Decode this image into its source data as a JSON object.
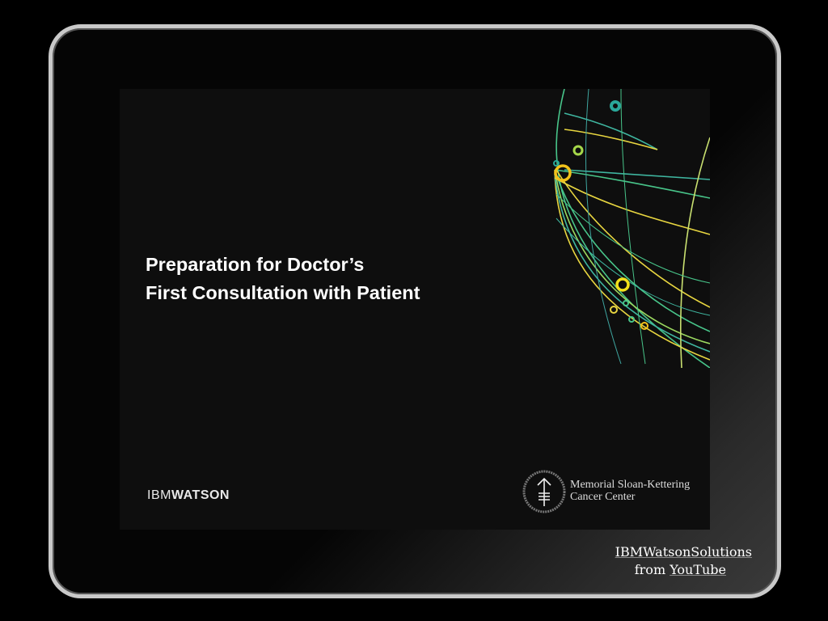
{
  "slide": {
    "title_line1": "Preparation for Doctor’s",
    "title_line2": "First Consultation with Patient",
    "brand_ibm": "IBM",
    "brand_watson": "WATSON",
    "partner_line1": "Memorial Sloan-Kettering",
    "partner_line2": "Cancer Center"
  },
  "watermark": {
    "channel": "IBMWatsonSolutions",
    "from": "from",
    "source": "YouTube"
  },
  "colors": {
    "background": "#0e0e0e",
    "bezel": "#c9c9c9",
    "accent_yellow": "#f2d21b",
    "accent_green": "#5fd08a",
    "accent_teal": "#2aa89a"
  }
}
